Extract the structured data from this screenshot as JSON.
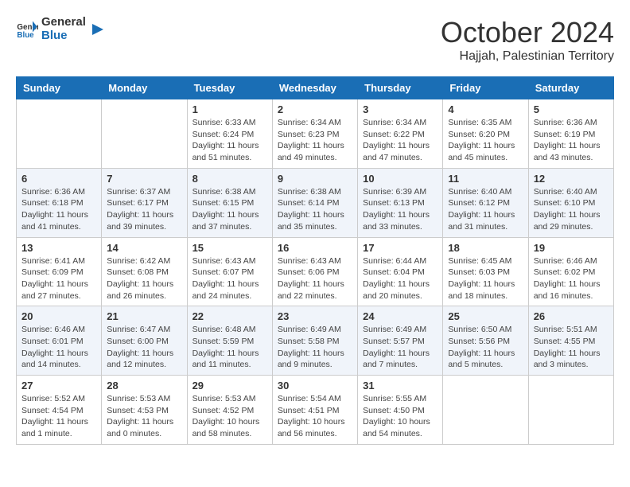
{
  "header": {
    "logo_general": "General",
    "logo_blue": "Blue",
    "month": "October 2024",
    "location": "Hajjah, Palestinian Territory"
  },
  "weekdays": [
    "Sunday",
    "Monday",
    "Tuesday",
    "Wednesday",
    "Thursday",
    "Friday",
    "Saturday"
  ],
  "weeks": [
    [
      {
        "day": "",
        "info": ""
      },
      {
        "day": "",
        "info": ""
      },
      {
        "day": "1",
        "info": "Sunrise: 6:33 AM\nSunset: 6:24 PM\nDaylight: 11 hours and 51 minutes."
      },
      {
        "day": "2",
        "info": "Sunrise: 6:34 AM\nSunset: 6:23 PM\nDaylight: 11 hours and 49 minutes."
      },
      {
        "day": "3",
        "info": "Sunrise: 6:34 AM\nSunset: 6:22 PM\nDaylight: 11 hours and 47 minutes."
      },
      {
        "day": "4",
        "info": "Sunrise: 6:35 AM\nSunset: 6:20 PM\nDaylight: 11 hours and 45 minutes."
      },
      {
        "day": "5",
        "info": "Sunrise: 6:36 AM\nSunset: 6:19 PM\nDaylight: 11 hours and 43 minutes."
      }
    ],
    [
      {
        "day": "6",
        "info": "Sunrise: 6:36 AM\nSunset: 6:18 PM\nDaylight: 11 hours and 41 minutes."
      },
      {
        "day": "7",
        "info": "Sunrise: 6:37 AM\nSunset: 6:17 PM\nDaylight: 11 hours and 39 minutes."
      },
      {
        "day": "8",
        "info": "Sunrise: 6:38 AM\nSunset: 6:15 PM\nDaylight: 11 hours and 37 minutes."
      },
      {
        "day": "9",
        "info": "Sunrise: 6:38 AM\nSunset: 6:14 PM\nDaylight: 11 hours and 35 minutes."
      },
      {
        "day": "10",
        "info": "Sunrise: 6:39 AM\nSunset: 6:13 PM\nDaylight: 11 hours and 33 minutes."
      },
      {
        "day": "11",
        "info": "Sunrise: 6:40 AM\nSunset: 6:12 PM\nDaylight: 11 hours and 31 minutes."
      },
      {
        "day": "12",
        "info": "Sunrise: 6:40 AM\nSunset: 6:10 PM\nDaylight: 11 hours and 29 minutes."
      }
    ],
    [
      {
        "day": "13",
        "info": "Sunrise: 6:41 AM\nSunset: 6:09 PM\nDaylight: 11 hours and 27 minutes."
      },
      {
        "day": "14",
        "info": "Sunrise: 6:42 AM\nSunset: 6:08 PM\nDaylight: 11 hours and 26 minutes."
      },
      {
        "day": "15",
        "info": "Sunrise: 6:43 AM\nSunset: 6:07 PM\nDaylight: 11 hours and 24 minutes."
      },
      {
        "day": "16",
        "info": "Sunrise: 6:43 AM\nSunset: 6:06 PM\nDaylight: 11 hours and 22 minutes."
      },
      {
        "day": "17",
        "info": "Sunrise: 6:44 AM\nSunset: 6:04 PM\nDaylight: 11 hours and 20 minutes."
      },
      {
        "day": "18",
        "info": "Sunrise: 6:45 AM\nSunset: 6:03 PM\nDaylight: 11 hours and 18 minutes."
      },
      {
        "day": "19",
        "info": "Sunrise: 6:46 AM\nSunset: 6:02 PM\nDaylight: 11 hours and 16 minutes."
      }
    ],
    [
      {
        "day": "20",
        "info": "Sunrise: 6:46 AM\nSunset: 6:01 PM\nDaylight: 11 hours and 14 minutes."
      },
      {
        "day": "21",
        "info": "Sunrise: 6:47 AM\nSunset: 6:00 PM\nDaylight: 11 hours and 12 minutes."
      },
      {
        "day": "22",
        "info": "Sunrise: 6:48 AM\nSunset: 5:59 PM\nDaylight: 11 hours and 11 minutes."
      },
      {
        "day": "23",
        "info": "Sunrise: 6:49 AM\nSunset: 5:58 PM\nDaylight: 11 hours and 9 minutes."
      },
      {
        "day": "24",
        "info": "Sunrise: 6:49 AM\nSunset: 5:57 PM\nDaylight: 11 hours and 7 minutes."
      },
      {
        "day": "25",
        "info": "Sunrise: 6:50 AM\nSunset: 5:56 PM\nDaylight: 11 hours and 5 minutes."
      },
      {
        "day": "26",
        "info": "Sunrise: 5:51 AM\nSunset: 4:55 PM\nDaylight: 11 hours and 3 minutes."
      }
    ],
    [
      {
        "day": "27",
        "info": "Sunrise: 5:52 AM\nSunset: 4:54 PM\nDaylight: 11 hours and 1 minute."
      },
      {
        "day": "28",
        "info": "Sunrise: 5:53 AM\nSunset: 4:53 PM\nDaylight: 11 hours and 0 minutes."
      },
      {
        "day": "29",
        "info": "Sunrise: 5:53 AM\nSunset: 4:52 PM\nDaylight: 10 hours and 58 minutes."
      },
      {
        "day": "30",
        "info": "Sunrise: 5:54 AM\nSunset: 4:51 PM\nDaylight: 10 hours and 56 minutes."
      },
      {
        "day": "31",
        "info": "Sunrise: 5:55 AM\nSunset: 4:50 PM\nDaylight: 10 hours and 54 minutes."
      },
      {
        "day": "",
        "info": ""
      },
      {
        "day": "",
        "info": ""
      }
    ]
  ]
}
